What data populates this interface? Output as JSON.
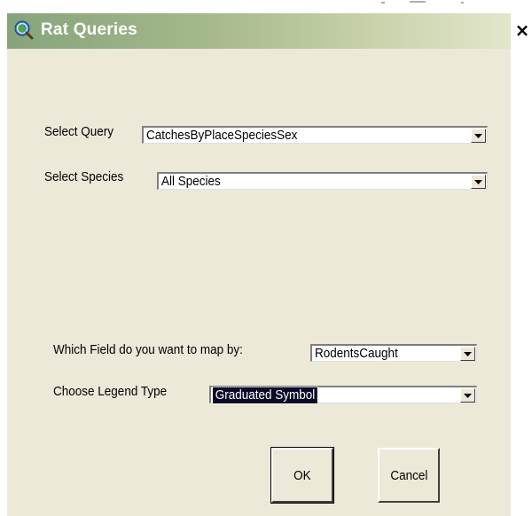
{
  "window": {
    "title": "Rat Queries",
    "close_label": "×",
    "icon": "globe-magnifier-icon"
  },
  "form": {
    "query": {
      "label": "Select Query",
      "value": "CatchesByPlaceSpeciesSex"
    },
    "species": {
      "label": "Select Species",
      "value": "All Species"
    },
    "field": {
      "label": "Which Field do you want to map by:",
      "value": "RodentsCaught"
    },
    "legend": {
      "label": "Choose Legend Type",
      "value": "Graduated Symbol"
    }
  },
  "buttons": {
    "ok": "OK",
    "cancel": "Cancel"
  },
  "colors": {
    "title_gradient_start": "#86a47c",
    "title_gradient_end": "#e2e6cc",
    "dialog_background": "#ece9d8",
    "selection_background": "#0a0a28"
  }
}
